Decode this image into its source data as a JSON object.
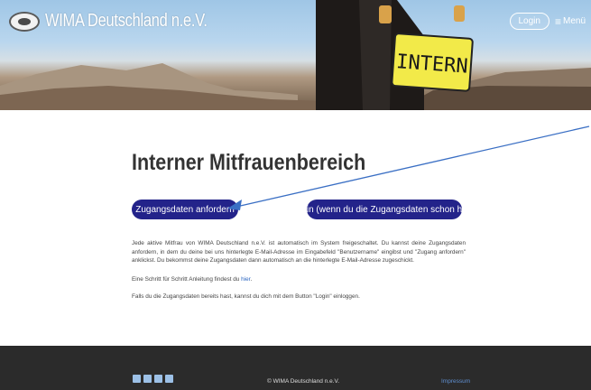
{
  "header": {
    "site_name": "WIMA Deutschland n.e.V.",
    "login_label": "Login",
    "menu_label": "Menü",
    "sign_text": "INTERN"
  },
  "main": {
    "title": "Interner Mitfrauenbereich",
    "request_button": "Zugangsdaten anfordern",
    "login_button": "Login (wenn du die Zugangsdaten schon hast)",
    "paragraph1": "Jede aktive Mitfrau von WIMA Deutschland n.e.V. ist automatisch im System freigeschaltet. Du kannst deine Zugangsdaten anfordern, in dem du deine bei uns hinterlegte E-Mail-Adresse im Eingabefeld \"Benutzername\" eingibst und \"Zugang anfordern\" anklickst. Du bekommst deine Zugangsdaten dann automatisch an die hinterlegte E-Mail-Adresse zugeschickt.",
    "paragraph2_prefix": "Eine Schritt für Schritt Anleitung findest du ",
    "paragraph2_link": "hier",
    "paragraph2_suffix": ".",
    "paragraph3": "Falls du die Zugangsdaten bereits hast, kannst du dich mit dem Button \"Login\" einloggen."
  },
  "footer": {
    "copyright": "© WIMA Deutschland n.e.V.",
    "impressum": "Impressum"
  },
  "icons": [
    "facebook-icon",
    "youtube-icon",
    "instagram-icon",
    "email-icon"
  ],
  "colors": {
    "button_bg": "#23238a",
    "footer_bg": "#2b2b2b",
    "link": "#2a65c0",
    "annotation_arrow": "#3a6fc4"
  }
}
